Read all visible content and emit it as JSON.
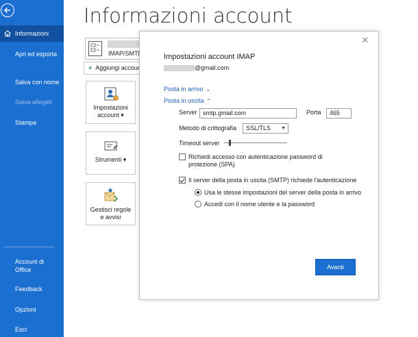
{
  "sidebar": {
    "items": [
      {
        "label": "Informazioni"
      },
      {
        "label": "Apri ed esporta"
      },
      {
        "label": "Salva con nome"
      },
      {
        "label": "Salva allegati"
      },
      {
        "label": "Stampa"
      },
      {
        "label": "Account di Office"
      },
      {
        "label": "Feedback"
      },
      {
        "label": "Opzioni"
      },
      {
        "label": "Esci"
      }
    ]
  },
  "main": {
    "title": "Informazioni account",
    "account_type": "IMAP/SMTP",
    "add_account": "Aggiungi account",
    "tiles": [
      {
        "label": "Impostazioni account ▾"
      },
      {
        "label": "Strumenti ▾"
      },
      {
        "label": "Gestisci regole e avvisi"
      }
    ]
  },
  "dialog": {
    "title": "Impostazioni account IMAP",
    "email_suffix": "@gmail.com",
    "incoming_link": "Posta in arrivo",
    "outgoing_link": "Posta in uscita",
    "server_label": "Server",
    "server_value": "smtp.gmail.com",
    "port_label": "Porta",
    "port_value": "465",
    "encryption_label": "Metodo di crittografia",
    "encryption_value": "SSL/TLS",
    "timeout_label": "Timeout server",
    "timeout_level": 0.05,
    "spa_label": "Richiedi accesso con autenticazione password di protezione (SPA)",
    "spa_checked": false,
    "auth_label": "Il server della posta in uscita (SMTP) richiede l'autenticazione",
    "auth_checked": true,
    "radio_same": "Usa le stesse impostazioni del server della posta in arrivo",
    "radio_login": "Accedi con il nome utente e la password",
    "next_button": "Avanti"
  },
  "colors": {
    "sidebar_bg": "#1a6fd1",
    "sidebar_active": "#10509e",
    "link": "#1d5fb5",
    "primary_button": "#1a6fd1"
  }
}
